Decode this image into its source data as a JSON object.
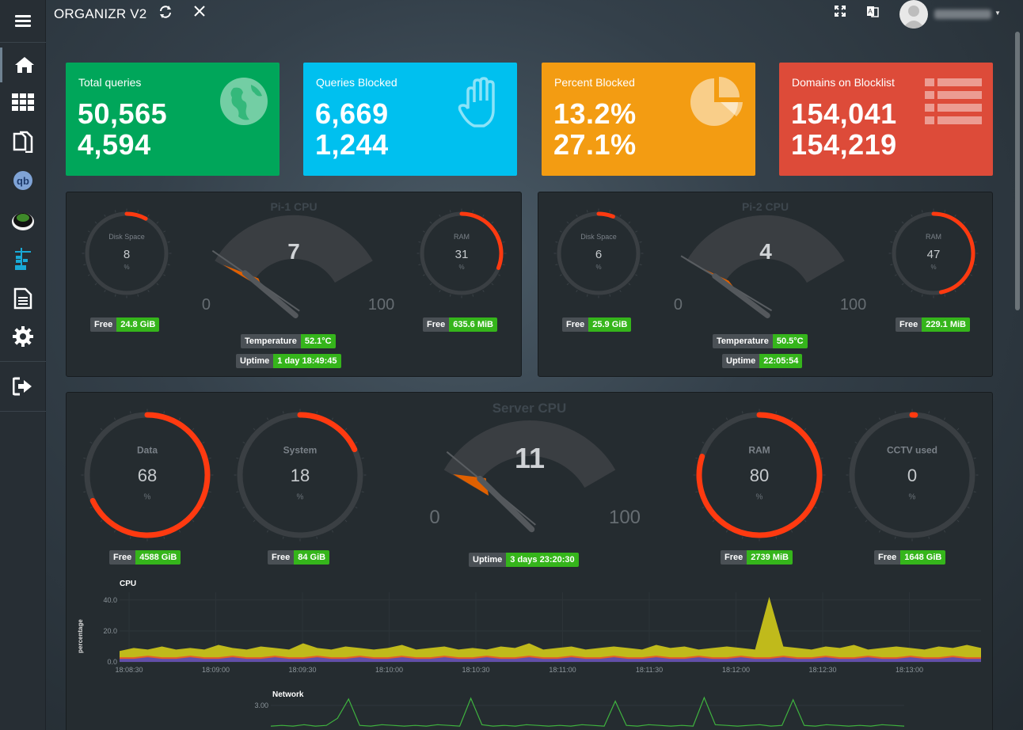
{
  "app": {
    "title": "ORGANIZR V2"
  },
  "topbar": {
    "refresh_icon": "refresh-icon",
    "close_icon": "close-icon",
    "fullscreen_icon": "fullscreen-icon",
    "translate_icon": "language-icon",
    "avatar_icon": "user-avatar",
    "user_menu_caret": "caret-down-icon"
  },
  "sidebar": {
    "items": [
      {
        "name": "menu",
        "icon": "hamburger-icon"
      },
      {
        "name": "home",
        "icon": "home-icon"
      },
      {
        "name": "apps",
        "icon": "grid-icon"
      },
      {
        "name": "documents",
        "icon": "copy-icon"
      },
      {
        "name": "qbittorrent",
        "icon": "qbittorrent-icon"
      },
      {
        "name": "ombi",
        "icon": "ombi-icon"
      },
      {
        "name": "portainer",
        "icon": "crane-icon"
      },
      {
        "name": "logs",
        "icon": "file-text-icon"
      },
      {
        "name": "settings",
        "icon": "gear-icon"
      },
      {
        "name": "logout",
        "icon": "logout-icon"
      }
    ]
  },
  "tiles": [
    {
      "label": "Total queries",
      "value1": "50,565",
      "value2": "4,594",
      "color": "#00a65a",
      "icon": "globe-icon"
    },
    {
      "label": "Queries Blocked",
      "value1": "6,669",
      "value2": "1,244",
      "color": "#00c0ef",
      "icon": "hand-icon"
    },
    {
      "label": "Percent Blocked",
      "value1": "13.2%",
      "value2": "27.1%",
      "color": "#f39c12",
      "icon": "pie-chart-icon"
    },
    {
      "label": "Domains on Blocklist",
      "value1": "154,041",
      "value2": "154,219",
      "color": "#dd4b39",
      "icon": "list-icon"
    }
  ],
  "pi1": {
    "title": "Pi-1 CPU",
    "cpu": {
      "value": 7,
      "min": "0",
      "max": "100"
    },
    "disk": {
      "label": "Disk Space",
      "value": 8,
      "unit": "%",
      "free_label": "Free",
      "free_value": "24.8 GiB"
    },
    "ram": {
      "label": "RAM",
      "value": 31,
      "unit": "%",
      "free_label": "Free",
      "free_value": "635.6 MiB"
    },
    "temperature": {
      "label": "Temperature",
      "value": "52.1°C"
    },
    "uptime": {
      "label": "Uptime",
      "value": "1 day 18:49:45"
    }
  },
  "pi2": {
    "title": "Pi-2 CPU",
    "cpu": {
      "value": 4,
      "min": "0",
      "max": "100"
    },
    "disk": {
      "label": "Disk Space",
      "value": 6,
      "unit": "%",
      "free_label": "Free",
      "free_value": "25.9 GiB"
    },
    "ram": {
      "label": "RAM",
      "value": 47,
      "unit": "%",
      "free_label": "Free",
      "free_value": "229.1 MiB"
    },
    "temperature": {
      "label": "Temperature",
      "value": "50.5°C"
    },
    "uptime": {
      "label": "Uptime",
      "value": "22:05:54"
    }
  },
  "server": {
    "title": "Server CPU",
    "cpu": {
      "value": 11,
      "min": "0",
      "max": "100"
    },
    "uptime": {
      "label": "Uptime",
      "value": "3 days 23:20:30"
    },
    "data": {
      "label": "Data",
      "value": 68,
      "unit": "%",
      "free_label": "Free",
      "free_value": "4588 GiB"
    },
    "system": {
      "label": "System",
      "value": 18,
      "unit": "%",
      "free_label": "Free",
      "free_value": "84 GiB"
    },
    "ram": {
      "label": "RAM",
      "value": 80,
      "unit": "%",
      "free_label": "Free",
      "free_value": "2739 MiB"
    },
    "cctv": {
      "label": "CCTV used",
      "value": 0,
      "unit": "%",
      "free_label": "Free",
      "free_value": "1648 GiB"
    }
  },
  "colors": {
    "gauge_arc": "#ff3a10",
    "gauge_track": "#3a3f43",
    "needle_fill": "#e06000",
    "badge_green": "#35b51b"
  },
  "chart_data": [
    {
      "type": "area",
      "title": "CPU",
      "ylabel": "percentage",
      "yticks": [
        "0.0",
        "20.0",
        "40.0"
      ],
      "ylim": [
        0,
        45
      ],
      "x": [
        "18:08:30",
        "18:09:00",
        "18:09:30",
        "18:10:00",
        "18:10:30",
        "18:11:00",
        "18:11:30",
        "18:12:00",
        "18:12:30",
        "18:13:00"
      ],
      "series": [
        {
          "color": "#c8c21a",
          "values": [
            7,
            9,
            8,
            10,
            8,
            9,
            8,
            11,
            9,
            8,
            10,
            9,
            8,
            12,
            9,
            8,
            10,
            9,
            8,
            9,
            11,
            8,
            9,
            10,
            8,
            9,
            8,
            10,
            9,
            12,
            8,
            9,
            10,
            8,
            9,
            10,
            9,
            8,
            11,
            9,
            10,
            8,
            9,
            10,
            9,
            8,
            42,
            10,
            9,
            8,
            10,
            9,
            11,
            8,
            9,
            10,
            9,
            8,
            10,
            9,
            11,
            9
          ]
        },
        {
          "color": "#e6552a",
          "values": [
            3,
            3,
            4,
            3,
            3,
            4,
            3,
            3,
            4,
            3,
            3,
            4,
            3,
            3,
            4,
            3,
            3,
            4,
            3,
            3,
            4,
            3,
            3,
            4,
            3,
            3,
            4,
            3,
            3,
            4,
            3,
            3,
            4,
            3,
            3,
            4,
            3,
            3,
            4,
            3,
            3,
            4,
            3,
            3,
            4,
            3,
            3,
            4,
            3,
            3,
            4,
            3,
            3,
            4,
            3,
            3,
            4,
            3,
            3,
            4,
            3,
            3
          ]
        },
        {
          "color": "#5b4fb0",
          "values": [
            2,
            2,
            3,
            2,
            2,
            3,
            2,
            2,
            3,
            2,
            2,
            3,
            2,
            2,
            3,
            2,
            2,
            3,
            2,
            2,
            3,
            2,
            2,
            3,
            2,
            2,
            3,
            2,
            2,
            3,
            2,
            2,
            3,
            2,
            2,
            3,
            2,
            2,
            3,
            2,
            2,
            3,
            2,
            2,
            3,
            2,
            2,
            3,
            2,
            2,
            3,
            2,
            2,
            3,
            2,
            2,
            3,
            2,
            2,
            3,
            2,
            2
          ]
        }
      ]
    },
    {
      "type": "line",
      "title": "Network",
      "yticks": [
        "3.00"
      ],
      "ylim": [
        0,
        4
      ],
      "series": [
        {
          "color": "#3fb33f",
          "values": [
            0.1,
            0.2,
            0.1,
            0.3,
            0.1,
            0.2,
            1.2,
            3.9,
            0.2,
            0.1,
            0.3,
            0.2,
            0.1,
            0.2,
            0.1,
            0.3,
            0.2,
            0.1,
            4.0,
            0.3,
            0.1,
            0.2,
            0.1,
            0.3,
            0.2,
            0.1,
            0.2,
            0.1,
            0.3,
            0.2,
            0.1,
            3.6,
            0.2,
            0.1,
            0.3,
            0.2,
            0.1,
            0.2,
            0.1,
            4.1,
            0.3,
            0.2,
            0.1,
            0.2,
            0.3,
            0.1,
            0.2,
            3.8,
            0.2,
            0.1,
            0.3,
            0.2,
            0.1,
            0.2,
            0.1,
            0.3,
            0.2,
            0.1
          ]
        }
      ]
    }
  ]
}
